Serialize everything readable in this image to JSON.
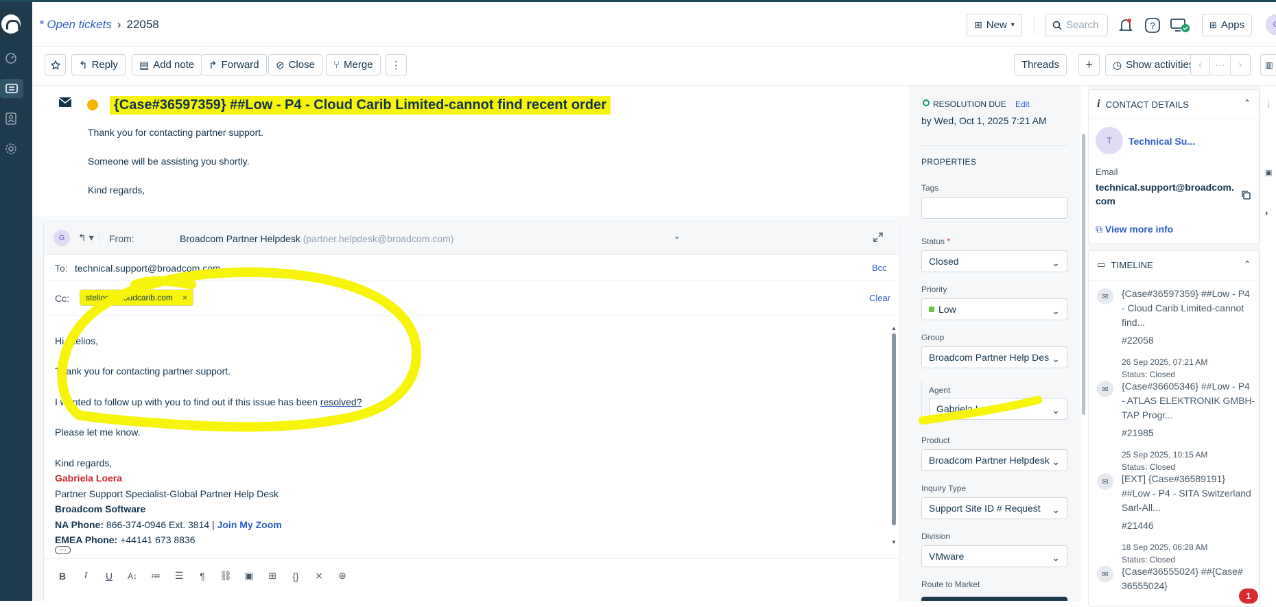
{
  "header": {
    "breadcrumb_link": "* Open tickets",
    "ticket_id": "22058",
    "new_label": "New",
    "search_placeholder": "Search",
    "apps_label": "Apps",
    "avatar_letter": "G"
  },
  "toolbar": {
    "reply": "Reply",
    "add_note": "Add note",
    "forward": "Forward",
    "close": "Close",
    "merge": "Merge",
    "more": "⋮",
    "threads": "Threads",
    "plus": "+",
    "show_activities": "Show activities",
    "pager_mid": "···"
  },
  "message": {
    "subject": "{Case#36597359} ##Low - P4 - Cloud Carib Limited-cannot find recent order",
    "lines": [
      "Thank you for contacting partner support.",
      "Someone will be assisting you shortly.",
      "Kind regards,"
    ]
  },
  "editor": {
    "from_label": "From:",
    "from_name": "Broadcom Partner Helpdesk",
    "from_email": "(partner.helpdesk@broadcom.com)",
    "avatar_letter": "G",
    "to_label": "To:",
    "to_value": "technical.support@broadcom.com",
    "bcc": "Bcc",
    "cc_label": "Cc:",
    "cc_chip": "stelios@cloudcarib.com",
    "cc_remove": "×",
    "clear": "Clear",
    "body": {
      "greeting": "Hi Stelios,",
      "p1": "Thank  you for contacting partner support.",
      "p2_prefix": "I wanted to follow up with you to find out if this issue has been ",
      "p2_link": "resolved?",
      "p3": "Please let me know.",
      "closing": "Kind regards,",
      "sig_name": "Gabriela Loera",
      "sig_title": "Partner Support Specialist-Global Partner Help Desk",
      "sig_company": "Broadcom Software",
      "na_label": "NA Phone:",
      "na_value": " 866-374-0946 Ext. 3814 | ",
      "zoom_link": "Join My Zoom",
      "emea_label": "EMEA Phone:",
      "emea_value": " +44141 673 8836",
      "ellipsis": "···"
    }
  },
  "properties": {
    "resolution_label": "RESOLUTION DUE",
    "resolution_edit": "Edit",
    "resolution_date": "by Wed, Oct 1, 2025 7:21 AM",
    "section_title": "PROPERTIES",
    "tags_label": "Tags",
    "status_label": "Status",
    "required_mark": "*",
    "status_value": "Closed",
    "priority_label": "Priority",
    "priority_value": "Low",
    "priority_color": "#6cc644",
    "group_label": "Group",
    "group_value": "Broadcom Partner Help Des",
    "agent_label": "Agent",
    "agent_value": "Gabriela Loera",
    "product_label": "Product",
    "product_value": "Broadcom Partner Helpdesk",
    "inquiry_label": "Inquiry Type",
    "inquiry_value": "Support Site ID # Request",
    "division_label": "Division",
    "division_value": "VMware",
    "route_label": "Route to Market"
  },
  "contact": {
    "title": "CONTACT DETAILS",
    "avatar_letter": "T",
    "name": "Technical Su...",
    "email_label": "Email",
    "email_line1": "technical.support@broadcom.",
    "email_line2": "com",
    "view_more": "View more info"
  },
  "timeline": {
    "title": "TIMELINE",
    "items": [
      {
        "title": "{Case#36597359} ##Low - P4 - Cloud Carib Limited-cannot find...",
        "num": "#22058",
        "date": "26 Sep 2025, 07:21 AM",
        "status": "Status: Closed"
      },
      {
        "title": "{Case#36605346} ##Low - P4 - ATLAS ELEKTRONIK GMBH-TAP Progr...",
        "num": "#21985",
        "date": "25 Sep 2025, 10:15 AM",
        "status": "Status: Closed"
      },
      {
        "title": "[EXT] {Case#36589191} ##Low - P4 - SITA Switzerland Sarl-All...",
        "num": "#21446",
        "date": "18 Sep 2025, 06:28 AM",
        "status": "Status: Closed"
      },
      {
        "title": "{Case#36555024} ##{Case# 36555024}",
        "num": "",
        "date": "",
        "status": ""
      }
    ]
  },
  "notification_badge": "1",
  "colors": {
    "highlight": "#f7f30a",
    "accent": "#2c5cc5",
    "sidebar": "#1f3a4b"
  }
}
